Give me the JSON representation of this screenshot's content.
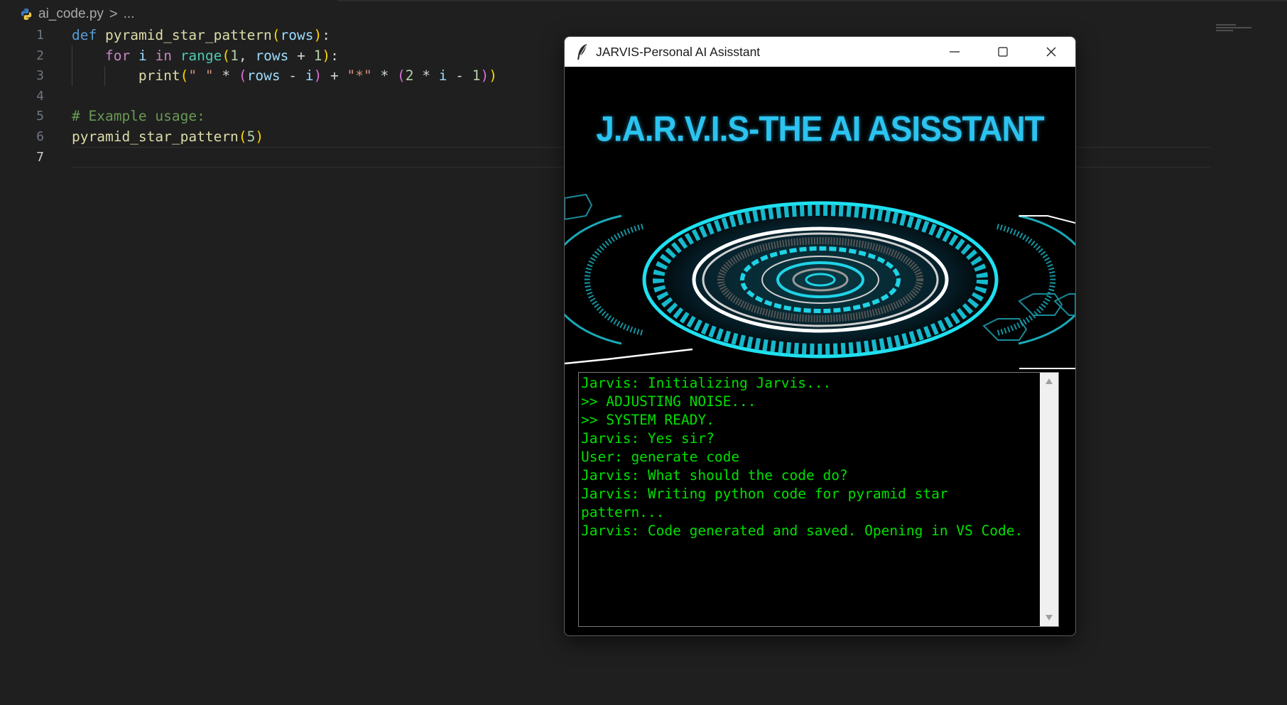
{
  "editor": {
    "breadcrumb": {
      "file": "ai_code.py",
      "separator": ">",
      "more": "..."
    },
    "line_numbers": [
      "1",
      "2",
      "3",
      "4",
      "5",
      "6",
      "7"
    ],
    "active_line": "7",
    "code_lines": [
      "def pyramid_star_pattern(rows):",
      "    for i in range(1, rows + 1):",
      "        print(\" \" * (rows - i) + \"*\" * (2 * i - 1))",
      "",
      "# Example usage:",
      "pyramid_star_pattern(5)",
      ""
    ],
    "tokens": {
      "l1": {
        "def": "def",
        "fn": "pyramid_star_pattern",
        "open": "(",
        "param": "rows",
        "close": ")",
        "colon": ":"
      },
      "l2": {
        "for": "for",
        "i": "i",
        "in": "in",
        "range": "range",
        "open": "(",
        "one": "1",
        "comma": ", ",
        "rows": "rows",
        "plus": " + ",
        "one2": "1",
        "close": ")",
        "colon": ":"
      },
      "l3": {
        "print": "print",
        "open": "(",
        "str1": "\" \"",
        "mul1": " * ",
        "p_open": "(",
        "rows": "rows",
        "minus": " - ",
        "i": "i",
        "p_close": ")",
        "plus": " + ",
        "str2": "\"*\"",
        "mul2": " * ",
        "p2_open": "(",
        "two": "2",
        "mul3": " * ",
        "i2": "i",
        "minus2": " - ",
        "one": "1",
        "p2_close": ")",
        "close": ")"
      },
      "l5": {
        "comment": "# Example usage:"
      },
      "l6": {
        "fn": "pyramid_star_pattern",
        "open": "(",
        "five": "5",
        "close": ")"
      }
    }
  },
  "jarvis": {
    "window_title": "JARVIS-Personal AI Asisstant",
    "banner_title": "J.A.R.V.I.S-THE AI ASISSTANT",
    "log": [
      "Jarvis: Initializing Jarvis...",
      ">> ADJUSTING NOISE...",
      ">> SYSTEM READY.",
      "Jarvis: Yes sir?",
      "User: generate code",
      "Jarvis: What should the code do?",
      "Jarvis: Writing python code for pyramid star",
      "pattern...",
      "Jarvis: Code generated and saved. Opening in VS Code."
    ],
    "colors": {
      "accent": "#2bc3f0",
      "log_text": "#00e000",
      "hud": "#1fd3e6"
    },
    "icons": {
      "app": "feather-icon",
      "minimize": "minimize-icon",
      "maximize": "maximize-icon",
      "close": "close-icon",
      "scroll_up": "scroll-up-arrow-icon",
      "scroll_down": "scroll-down-arrow-icon"
    }
  }
}
